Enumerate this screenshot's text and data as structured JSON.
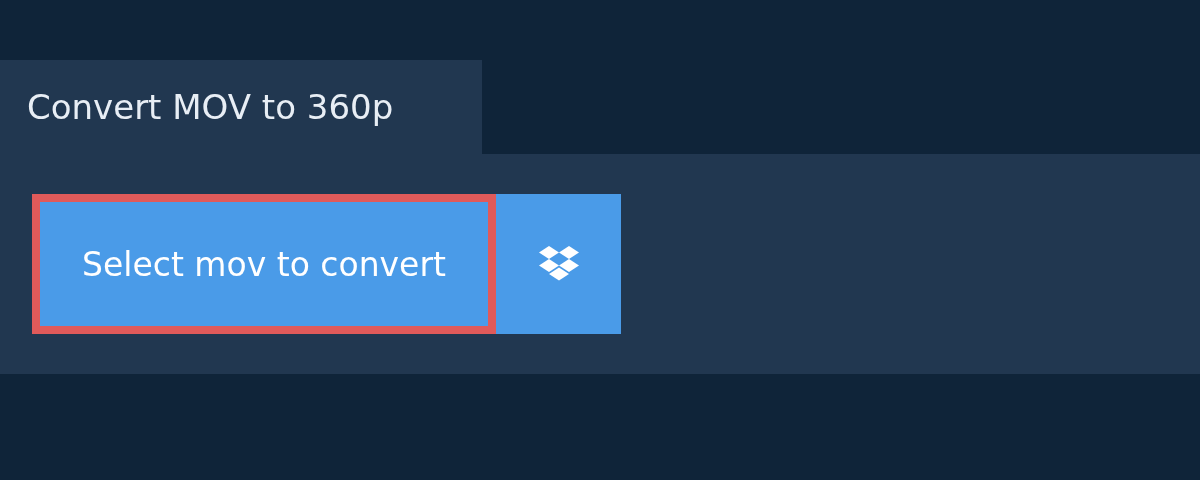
{
  "tab": {
    "title": "Convert MOV to 360p"
  },
  "select_button": {
    "label": "Select mov to convert"
  }
}
